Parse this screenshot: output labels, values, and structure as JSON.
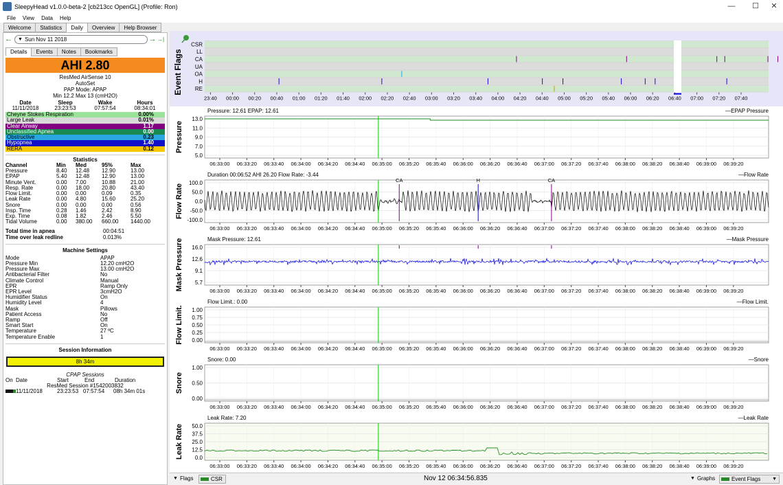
{
  "window": {
    "title": "SleepyHead v1.0.0-beta-2 [cb213cc OpenGL] (Profile: Ron)",
    "min": "—",
    "max": "☐",
    "close": "✕"
  },
  "menu": [
    "File",
    "View",
    "Data",
    "Help"
  ],
  "tabs": [
    "Welcome",
    "Statistics",
    "Daily",
    "Overview",
    "Help Browser"
  ],
  "date_nav": {
    "prev": "←",
    "date": "Sun Nov 11 2018",
    "next": "→",
    "last": "→|"
  },
  "subtabs": [
    "Details",
    "Events",
    "Notes",
    "Bookmarks"
  ],
  "ahi": {
    "label": "AHI 2.80",
    "machine": "ResMed AirSense 10",
    "model": "AutoSet",
    "mode": "PAP Mode: APAP",
    "range": "Min 12.2 Max 13 (cmH2O)"
  },
  "summary": {
    "headers": [
      "Date",
      "Sleep",
      "Wake",
      "Hours"
    ],
    "values": [
      "11/11/2018",
      "23:23:53",
      "07:57:54",
      "08:34:01"
    ]
  },
  "indices": [
    {
      "name": "Cheyne Stokes Respiration",
      "val": "0.00%",
      "bg": "#9be29b",
      "fg": "#000"
    },
    {
      "name": "Large Leak",
      "val": "0.01%",
      "bg": "#d9d9d9",
      "fg": "#000"
    },
    {
      "name": "Clear Airway",
      "val": "1.17",
      "bg": "#800080",
      "fg": "#fff"
    },
    {
      "name": "Unclassified Apnea",
      "val": "0.00",
      "bg": "#1a8a50",
      "fg": "#fff"
    },
    {
      "name": "Obstructive",
      "val": "0.23",
      "bg": "#2aa7e0",
      "fg": "#000"
    },
    {
      "name": "Hypopnea",
      "val": "1.40",
      "bg": "#1010c8",
      "fg": "#fff"
    },
    {
      "name": "RERA",
      "val": "0.12",
      "bg": "#f5c800",
      "fg": "#000"
    }
  ],
  "statistics": {
    "title": "Statistics",
    "headers": [
      "Channel",
      "Min",
      "Med",
      "95%",
      "Max"
    ],
    "rows": [
      [
        "Pressure",
        "8.40",
        "12.48",
        "12.90",
        "13.00"
      ],
      [
        "EPAP",
        "5.40",
        "12.48",
        "12.90",
        "13.00"
      ],
      [
        "Minute Vent.",
        "0.00",
        "7.00",
        "10.88",
        "21.00"
      ],
      [
        "Resp. Rate",
        "0.00",
        "18.00",
        "20.80",
        "43.40"
      ],
      [
        "Flow Limit.",
        "0.00",
        "0.00",
        "0.09",
        "0.35"
      ],
      [
        "Leak Rate",
        "0.00",
        "4.80",
        "15.60",
        "25.20"
      ],
      [
        "Snore",
        "0.00",
        "0.00",
        "0.00",
        "0.56"
      ],
      [
        "Insp. Time",
        "0.28",
        "1.46",
        "2.42",
        "8.90"
      ],
      [
        "Exp. Time",
        "0.08",
        "1.82",
        "2.46",
        "5.50"
      ],
      [
        "Tidal Volume",
        "0.00",
        "380.00",
        "660.00",
        "1440.00"
      ]
    ]
  },
  "totals": [
    [
      "Total time in apnea",
      "00:04:51"
    ],
    [
      "Time over leak redline",
      "0.013%"
    ]
  ],
  "machine_settings": {
    "title": "Machine Settings",
    "rows": [
      [
        "Mode",
        "APAP"
      ],
      [
        "Pressure Min",
        "12.20 cmH2O"
      ],
      [
        "Pressure Max",
        "13.00 cmH2O"
      ],
      [
        "Antibacterial Filter",
        "No"
      ],
      [
        "Climate Control",
        "Manual"
      ],
      [
        "EPR",
        "Ramp Only"
      ],
      [
        "EPR Level",
        "3cmH2O"
      ],
      [
        "Humidifier Status",
        "On"
      ],
      [
        "Humidity Level",
        "4"
      ],
      [
        "Mask",
        "Pillows"
      ],
      [
        "Patient Access",
        "No"
      ],
      [
        "Ramp",
        "Off"
      ],
      [
        "Smart Start",
        "On"
      ],
      [
        "Temperature",
        "27 ºC"
      ],
      [
        "Temperature Enable",
        "1"
      ]
    ]
  },
  "session_info": {
    "title": "Session Information",
    "bar": "8h 34m"
  },
  "sessions": {
    "title": "CPAP Sessions",
    "headers": [
      "On",
      "Date",
      "Start",
      "End",
      "Duration"
    ],
    "label": "ResMed Session #1542003832",
    "row": [
      "11/11/2018",
      "23:23:53",
      "07:57:54",
      "08h 34m 01s"
    ]
  },
  "event_flags": {
    "label": "Event Flags",
    "rows": [
      "CSR",
      "LL",
      "CA",
      "UA",
      "OA",
      "H",
      "RE"
    ],
    "ticks": [
      "23:40",
      "00:00",
      "00:20",
      "00:40",
      "01:00",
      "01:20",
      "01:40",
      "02:00",
      "02:20",
      "02:40",
      "03:00",
      "03:20",
      "03:40",
      "04:00",
      "04:20",
      "04:40",
      "05:00",
      "05:20",
      "05:40",
      "06:00",
      "06:20",
      "06:40",
      "07:00",
      "07:20",
      "07:40"
    ],
    "ca": [
      4.28,
      5.94,
      7.3,
      7.42,
      8.07,
      8.22,
      8.37,
      8.55
    ],
    "oa": [
      2.55
    ],
    "h": [
      0.7,
      2.25,
      3.85,
      4.67,
      4.98,
      5.86,
      6.22,
      6.37,
      7.45,
      8.44
    ],
    "re": [
      4.85
    ]
  },
  "time_ticks": [
    "06:33:00",
    "06:33:20",
    "06:33:40",
    "06:34:00",
    "06:34:20",
    "06:34:40",
    "06:35:00",
    "06:35:20",
    "06:35:40",
    "06:36:00",
    "06:36:20",
    "06:36:40",
    "06:37:00",
    "06:37:20",
    "06:37:40",
    "06:38:00",
    "06:38:20",
    "06:38:40",
    "06:39:00",
    "06:39:20"
  ],
  "charts": [
    {
      "label": "Pressure",
      "info": "Pressure: 12.61 EPAP: 12.61",
      "legend": "EPAP Pressure",
      "yticks": [
        "13.0",
        "11.0",
        "9.0",
        "7.0",
        "5.0"
      ]
    },
    {
      "label": "Flow Rate",
      "info": "Duration 00:06:52 AHI 26.20 Flow Rate: -3.44",
      "legend": "Flow Rate",
      "yticks": [
        "100.0",
        "50.0",
        "0.0",
        "-50.0",
        "-100.0"
      ],
      "events": [
        {
          "label": "CA",
          "t": 0.345
        },
        {
          "label": "H",
          "t": 0.485
        },
        {
          "label": "CA",
          "t": 0.615
        }
      ]
    },
    {
      "label": "Mask Pressure",
      "info": "Mask Pressure: 12.61",
      "legend": "Mask Pressure",
      "yticks": [
        "16.0",
        "12.6",
        "9.1",
        "5.7"
      ]
    },
    {
      "label": "Flow Limit.",
      "info": "Flow Limit.: 0.00",
      "legend": "Flow Limit.",
      "yticks": [
        "1.00",
        "0.75",
        "0.50",
        "0.25",
        "0.00"
      ]
    },
    {
      "label": "Snore",
      "info": "Snore: 0.00",
      "legend": "Snore",
      "yticks": [
        "1.00",
        "0.50",
        "0.00"
      ]
    },
    {
      "label": "Leak Rate",
      "info": "Leak Rate: 7.20",
      "legend": "Leak Rate",
      "yticks": [
        "50.0",
        "37.5",
        "25.0",
        "12.5",
        "0.0"
      ]
    }
  ],
  "bottom": {
    "flags": "Flags",
    "csr": "CSR",
    "time": "Nov 12 06:34:56.835",
    "graphs": "Graphs",
    "eventflags": "Event Flags"
  },
  "colors": {
    "plot_bg": "#ffffff",
    "leak_bg": "#f8fcf0",
    "flow_line": "#000000",
    "mask_line": "#0000dd",
    "leak_line": "#228b22",
    "cursor": "#00cc00",
    "band": "#cfe9cf"
  }
}
